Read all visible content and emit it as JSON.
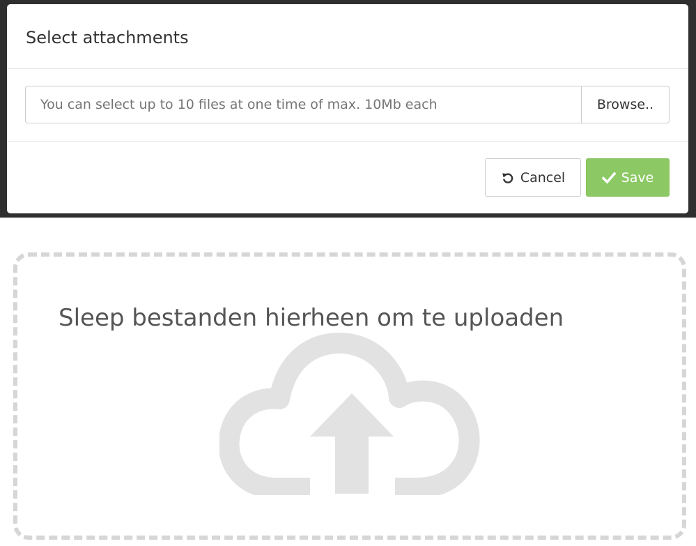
{
  "modal": {
    "title": "Select attachments",
    "file_input": {
      "placeholder": "You can select up to 10 files at one time of max. 10Mb each",
      "value": ""
    },
    "browse_label": "Browse..",
    "cancel_label": "Cancel",
    "save_label": "Save",
    "icons": {
      "cancel": "undo-icon",
      "save": "checkmark-icon"
    }
  },
  "dropzone": {
    "text": "Sleep bestanden hierheen om te uploaden",
    "icon": "cloud-upload-icon"
  },
  "colors": {
    "save_button": "#8cc864",
    "dropzone_border": "#d6d6d6",
    "cloud_icon": "#e2e2e2",
    "backdrop": "#2f2f2f"
  }
}
